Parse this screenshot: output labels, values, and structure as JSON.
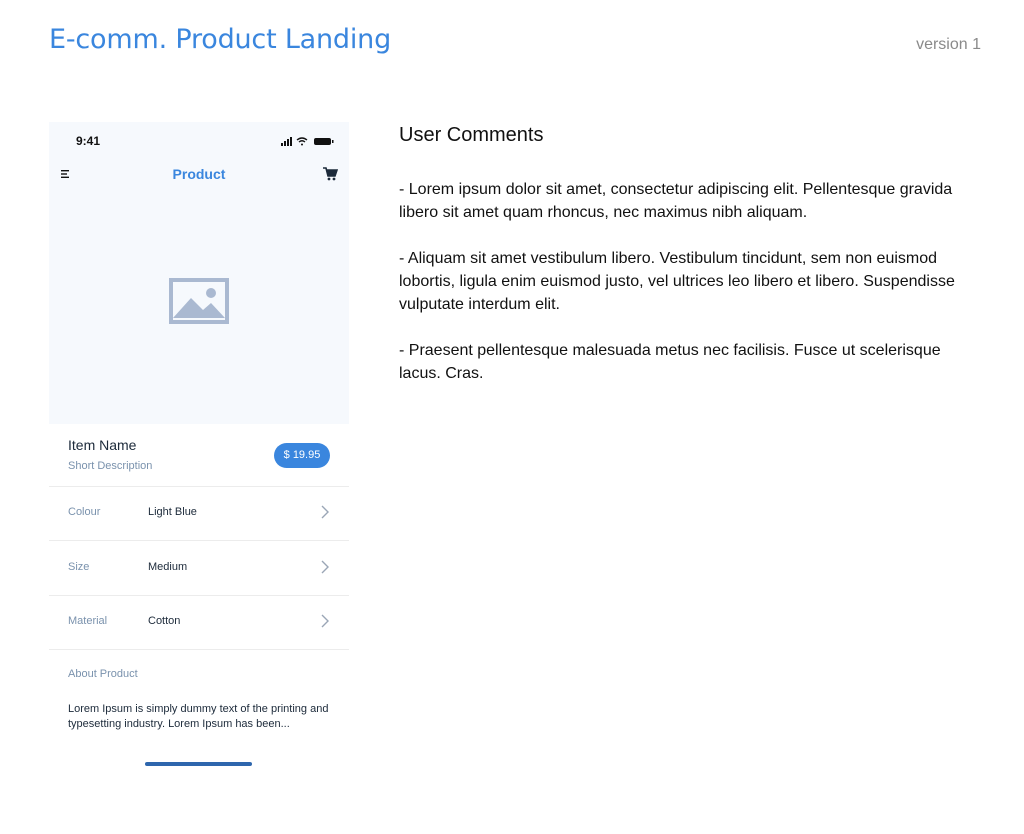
{
  "header": {
    "title": "E-comm. Product Landing",
    "version": "version 1"
  },
  "phone": {
    "status_bar": {
      "time": "9:41"
    },
    "nav": {
      "title": "Product",
      "menu_icon": "menu-icon",
      "cart_icon": "cart-icon"
    },
    "image": {
      "icon": "image-placeholder-icon"
    },
    "item": {
      "name": "Item Name",
      "description": "Short Description",
      "price": "$ 19.95"
    },
    "options": [
      {
        "label": "Colour",
        "value": "Light Blue"
      },
      {
        "label": "Size",
        "value": "Medium"
      },
      {
        "label": "Material",
        "value": "Cotton"
      }
    ],
    "about": {
      "label": "About Product",
      "text": "Lorem Ipsum is simply dummy text of the printing and typesetting industry. Lorem Ipsum has been..."
    }
  },
  "comments": {
    "title": "User Comments",
    "items": [
      "- Lorem ipsum dolor sit amet, consectetur adipiscing elit. Pellentesque gravida libero sit amet quam rhoncus, nec maximus nibh aliquam.",
      "- Aliquam sit amet vestibulum libero. Vestibulum tincidunt, sem non euismod lobortis, ligula enim euismod justo, vel ultrices leo libero et libero. Suspendisse vulputate interdum elit.",
      "- Praesent pellentesque malesuada metus nec facilisis. Fusce ut scelerisque lacus. Cras."
    ]
  },
  "colors": {
    "accent": "#3a86de",
    "muted_text": "#7a92ad",
    "panel_bg": "#f6f9fd"
  }
}
